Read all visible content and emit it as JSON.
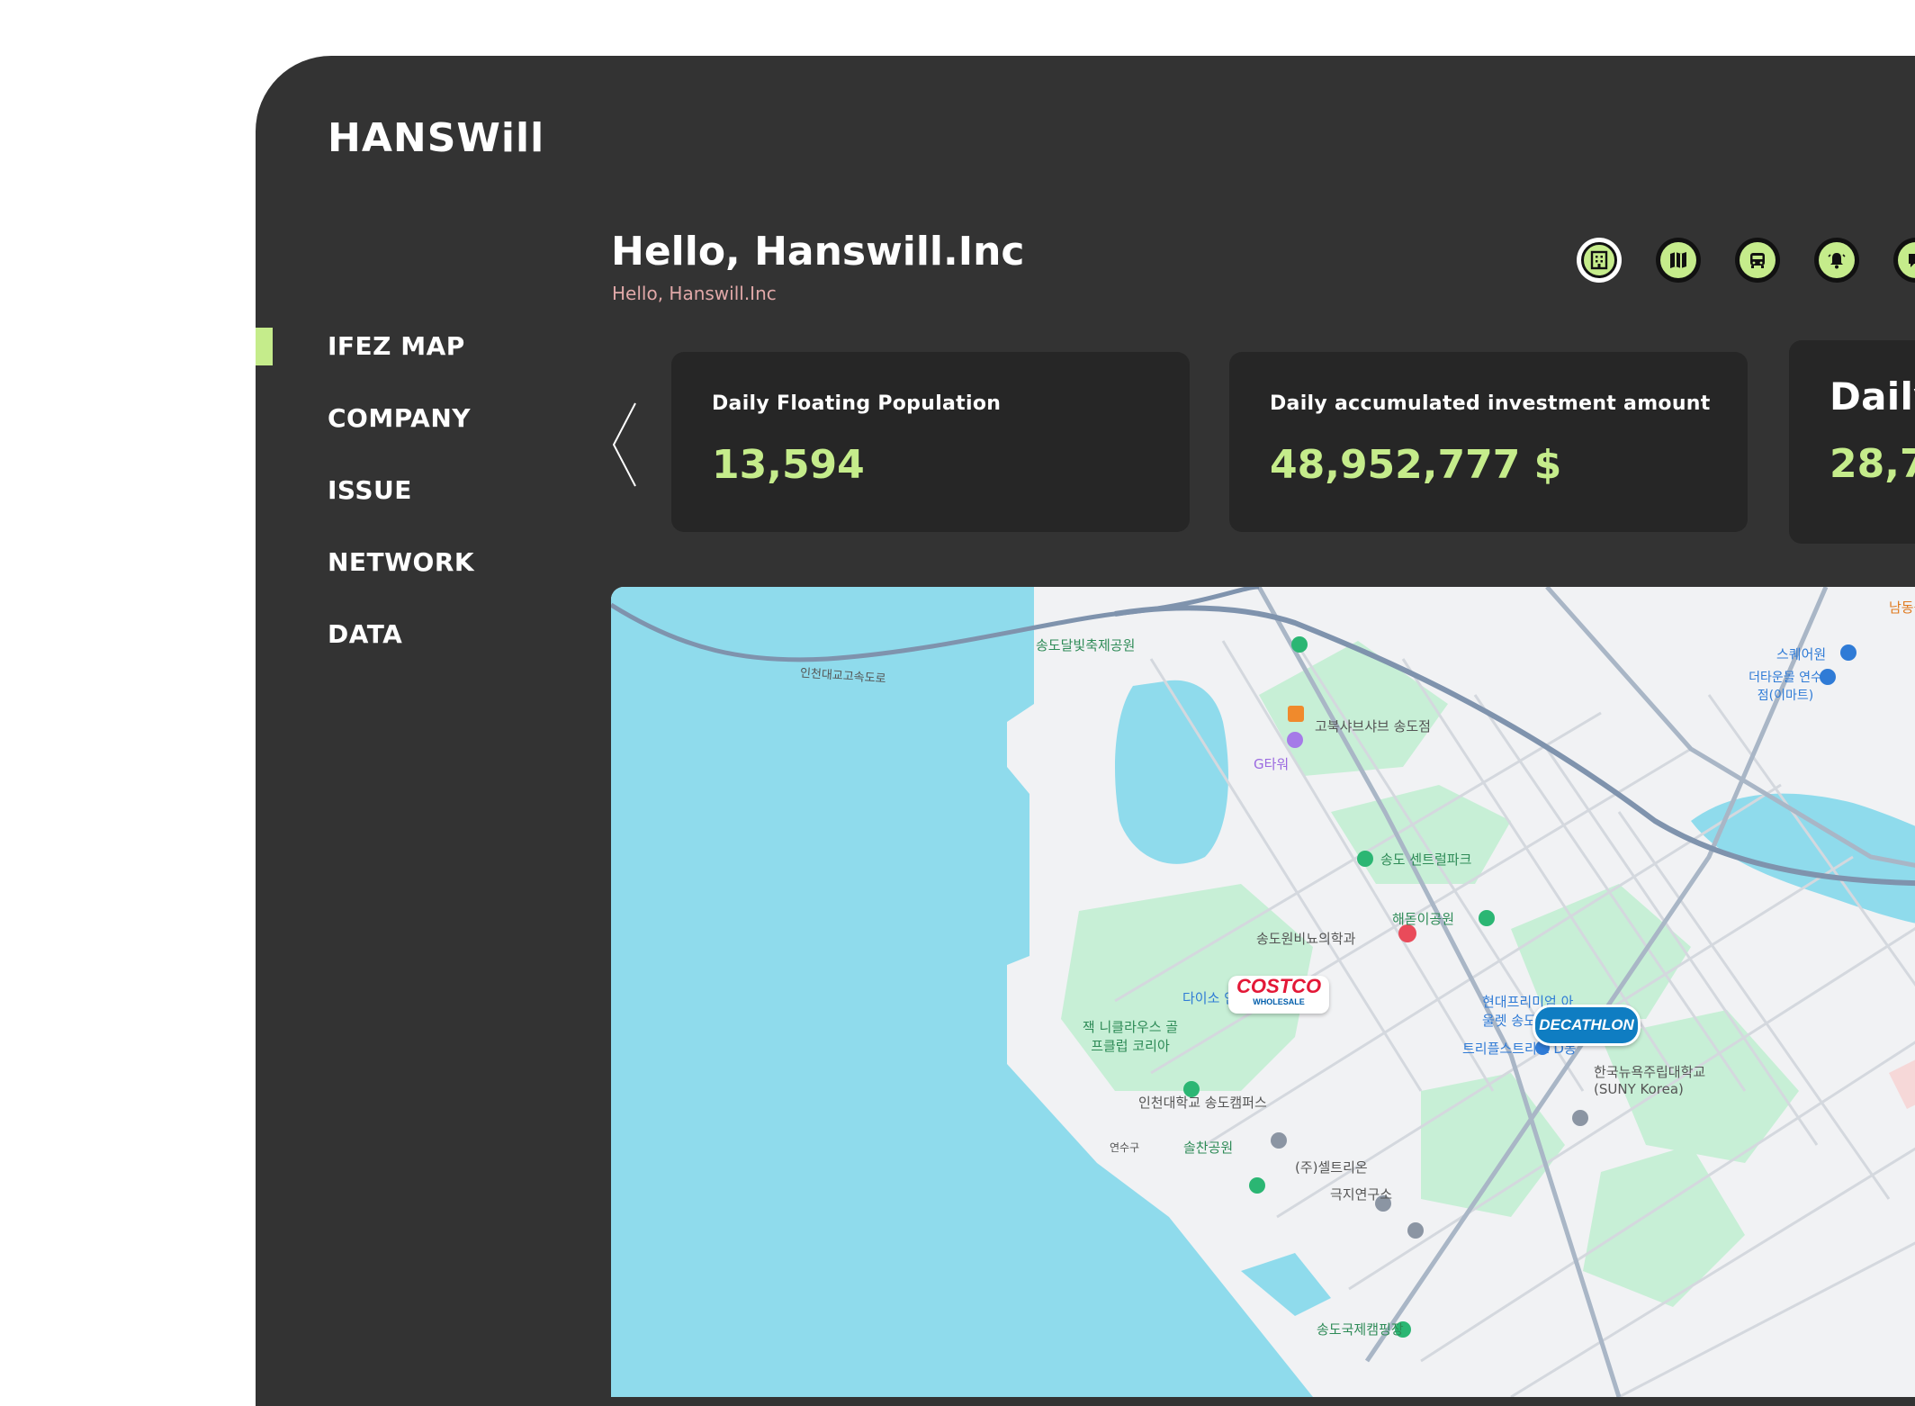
{
  "app": {
    "logo": "HANSWill"
  },
  "sidebar": {
    "items": [
      {
        "label": "IFEZ MAP",
        "active": true
      },
      {
        "label": "COMPANY",
        "active": false
      },
      {
        "label": "ISSUE",
        "active": false
      },
      {
        "label": "NETWORK",
        "active": false
      },
      {
        "label": "DATA",
        "active": false
      }
    ]
  },
  "header": {
    "greeting": "Hello, Hanswill.Inc",
    "subgreeting": "Hello, Hanswill.Inc",
    "icons": [
      "building-icon",
      "map-icon",
      "bus-icon",
      "bell-icon",
      "chat-icon"
    ]
  },
  "stats": {
    "cards": [
      {
        "label": "Daily Floating Population",
        "value": "13,594"
      },
      {
        "label": "Daily accumulated investment amount",
        "value": "48,952,777 $"
      },
      {
        "label": "Daily",
        "value": "28,7"
      }
    ]
  },
  "map": {
    "labels": {
      "park1": "송도달빛축제공원",
      "restaurant": "고북샤브샤브 송도점",
      "gtower": "G타워",
      "central_park": "송도 센트럴파크",
      "haedoji": "해돋이공원",
      "clinic": "송도원비뇨의학과",
      "daiso": "다이소 인천송도점",
      "golf": "잭 니클라우스 골프클럽 코리아",
      "outlet": "현대프리미엄 아울렛 송도",
      "triple": "트리플스트리트 D동",
      "suny": "한국뉴욕주립대학교(SUNY Korea)",
      "inu": "인천대학교 송도캠퍼스",
      "solchan": "솔찬공원",
      "celltrion": "(주)셀트리온",
      "polar": "극지연구소",
      "camping": "송도국제캠핑장",
      "bridge": "인천대교고속도로",
      "square": "스퀘어원",
      "emart": "더타운몰 연수점(이마트)",
      "namdong": "남동공",
      "yeonsu": "연수구",
      "costco": "COSTCO",
      "costco_sub": "WHOLESALE",
      "decathlon": "DECATHLON"
    }
  }
}
